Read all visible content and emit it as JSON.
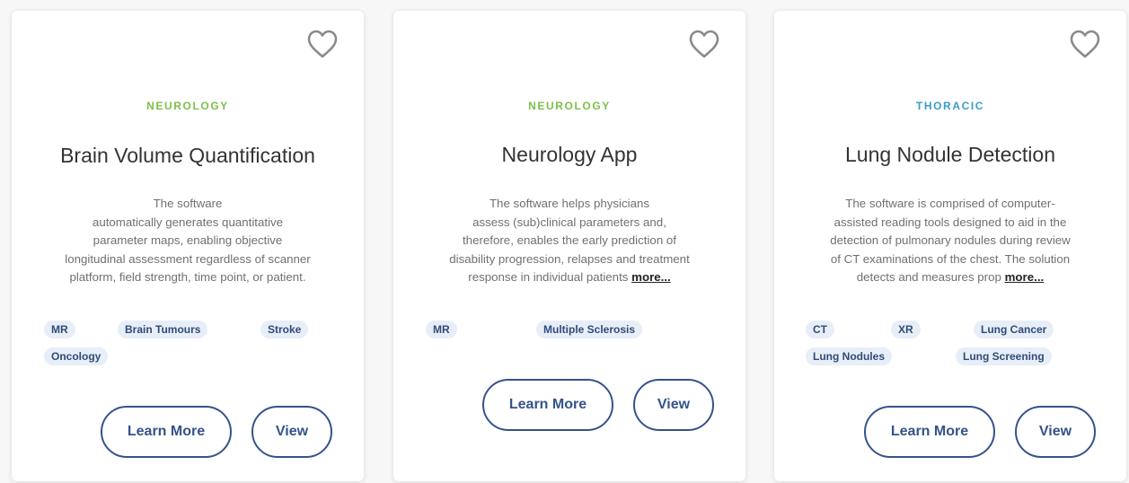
{
  "colors": {
    "neurology": "#7cc04a",
    "thoracic": "#3a9ec8",
    "tag_bg": "#e8eef8",
    "tag_text": "#2f4c78",
    "button_border": "#34538a",
    "heart": "#8a8a8a"
  },
  "cards": [
    {
      "favorite_icon": "heart-outline-icon",
      "category": "NEUROLOGY",
      "title": "Brain Volume Quantification",
      "desc_lines": [
        "The software",
        "automatically generates quantitative",
        "parameter maps, enabling objective",
        "longitudinal assessment regardless of scanner",
        "platform, field strength, time point, or patient."
      ],
      "more_label": "",
      "tags": [
        "MR",
        "Brain Tumours",
        "Stroke",
        "Oncology"
      ],
      "learn_more_label": "Learn More",
      "view_label": "View"
    },
    {
      "favorite_icon": "heart-outline-icon",
      "category": "NEUROLOGY",
      "title": "Neurology App",
      "desc_lines": [
        "The software helps physicians",
        "assess (sub)clinical parameters and,",
        "therefore, enables the early prediction of",
        "disability progression, relapses and treatment",
        "response in individual patients"
      ],
      "more_label": "more...",
      "tags": [
        "MR",
        "Multiple Sclerosis"
      ],
      "learn_more_label": "Learn More",
      "view_label": "View"
    },
    {
      "favorite_icon": "heart-outline-icon",
      "category": "THORACIC",
      "title": "Lung Nodule Detection",
      "desc_lines": [
        "The software is comprised of computer-",
        "assisted reading tools designed to aid in the",
        "detection of pulmonary nodules during review",
        "of CT examinations of the chest. The solution",
        "detects and measures prop"
      ],
      "more_label": "more...",
      "tags": [
        "CT",
        "XR",
        "Lung Cancer",
        "Lung Nodules",
        "Lung Screening"
      ],
      "learn_more_label": "Learn More",
      "view_label": "View"
    }
  ]
}
